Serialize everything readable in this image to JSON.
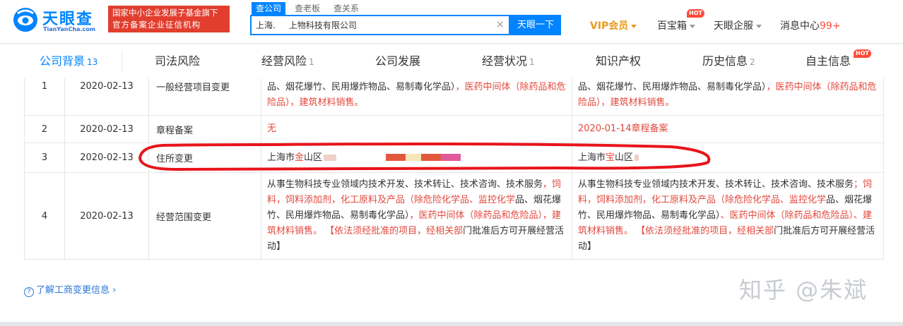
{
  "header": {
    "logo_text": "天眼查",
    "logo_domain": "TianYanCha.com",
    "badge_line1": "国家中小企业发展子基金旗下",
    "badge_line2": "官方备案企业征信机构",
    "search_tabs": [
      "查公司",
      "查老板",
      "查关系"
    ],
    "search_value": "上海.     上物科技有限公司",
    "search_button": "天眼一下",
    "nav": {
      "vip": "VIP会员",
      "baibaoxiang": "百宝箱",
      "qifu": "天眼企服",
      "messages": "消息中心",
      "message_count": "99+",
      "hot": "HOT"
    }
  },
  "subnav": [
    {
      "label": "公司背景",
      "count": "13"
    },
    {
      "label": "司法风险",
      "count": ""
    },
    {
      "label": "经营风险",
      "count": "1"
    },
    {
      "label": "公司发展",
      "count": ""
    },
    {
      "label": "经营状况",
      "count": "1"
    },
    {
      "label": "知识产权",
      "count": ""
    },
    {
      "label": "历史信息",
      "count": "2"
    },
    {
      "label": "自主信息",
      "count": ""
    }
  ],
  "rows": [
    {
      "no": "1",
      "date": "2020-02-13",
      "item": "一般经营项目变更",
      "before_a": "品、烟花爆竹、民用爆炸物品、易制毒化学品）",
      "before_b": "，医药中间体（除药品和危险品）",
      "before_c": "，建筑材料销售。",
      "after_a": "品、烟花爆竹、民用爆炸物品、易制毒化学品）",
      "after_b": "，医药中间体（除药品和危险品）",
      "after_c": "，建筑材料销售。"
    },
    {
      "no": "2",
      "date": "2020-02-13",
      "item": "章程备案",
      "before": "无",
      "after": "2020-01-14章程备案"
    },
    {
      "no": "3",
      "date": "2020-02-13",
      "item": "住所变更",
      "before_a": "上海市",
      "before_b": "金",
      "before_c": "山区",
      "after_a": "上海市",
      "after_b": "宝",
      "after_c": "山区"
    },
    {
      "no": "4",
      "date": "2020-02-13",
      "item": "经营范围变更",
      "before": [
        "从事生物科技专业领域内技术开发、技术转让、技术咨询、技术服务",
        "，饲料，饲料添加剂，化工原料及产品（除危险化学品、监控化学",
        "品、烟花爆竹、民用爆炸物品、易制毒化学品）",
        "，医药中间体（除药",
        "品和危险品）",
        "，建筑材料销售。 【依法须经批准的项目，经相关部",
        "门批准后方可开展经营活动】"
      ],
      "after": [
        "从事生物科技专业领域内技术开发、技术转让、技术咨询、技术服务",
        "；饲料，饲料添加剂，化工原料及产品（除危险化学品、监控化学",
        "品、烟花爆竹、民用爆炸物品、易制毒化学品）",
        "、医药中间体（除药",
        "品和危险品）",
        "、建筑材料销售。 【依法须经批准的项目，经相关部",
        "门批准后方可开展经营活动】"
      ]
    }
  ],
  "more_link": "了解工商变更信息",
  "watermark": "知乎 @朱斌",
  "colors": {
    "brand_blue": "#0084ff",
    "highlight_red": "#e2483d",
    "annotation_red": "#e8141b",
    "vip_orange": "#e89b1e"
  }
}
